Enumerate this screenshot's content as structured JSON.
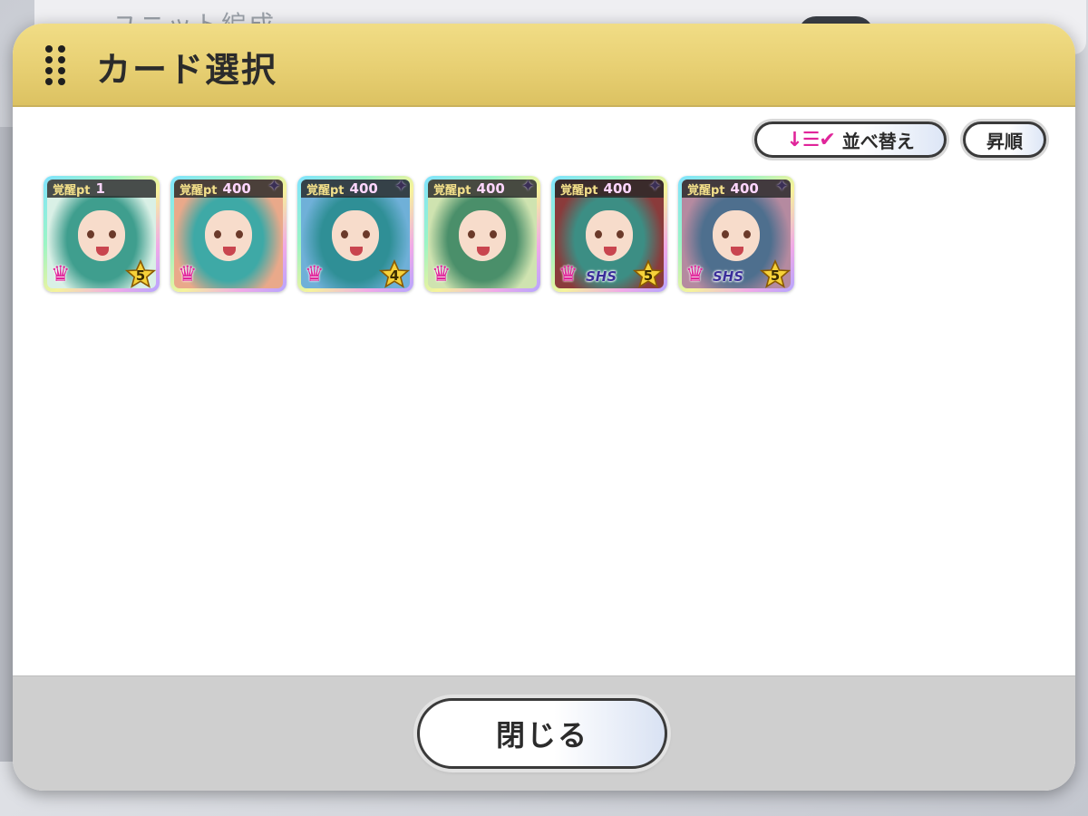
{
  "background": {
    "title": "ユニット編成"
  },
  "dialog": {
    "title": "カード選択",
    "sort": {
      "icon": "↓☰✔",
      "label": "並べ替え"
    },
    "order_label": "昇順",
    "close_label": "閉じる"
  },
  "cards": [
    {
      "pt_label": "覚醒pt",
      "pt_value": "1",
      "rank": "",
      "star_level": "5",
      "hair": "#3f9e8e",
      "bg": "#d9f0e6"
    },
    {
      "pt_label": "覚醒pt",
      "pt_value": "400",
      "rank": "",
      "star_level": "",
      "hair": "#3ea9a6",
      "bg": "#e9a98a"
    },
    {
      "pt_label": "覚醒pt",
      "pt_value": "400",
      "rank": "",
      "star_level": "4",
      "hair": "#2f8f96",
      "bg": "#6fb0d8"
    },
    {
      "pt_label": "覚醒pt",
      "pt_value": "400",
      "rank": "",
      "star_level": "",
      "hair": "#4a8f6a",
      "bg": "#cfe3b0"
    },
    {
      "pt_label": "覚醒pt",
      "pt_value": "400",
      "rank": "SHS",
      "star_level": "5",
      "hair": "#3c8e84",
      "bg": "#8a3b3b"
    },
    {
      "pt_label": "覚醒pt",
      "pt_value": "400",
      "rank": "SHS",
      "star_level": "5",
      "hair": "#4e6f8e",
      "bg": "#b58aa0"
    }
  ],
  "colors": {
    "accent_pink": "#e0259a",
    "header_gold": "#e7cf72"
  }
}
